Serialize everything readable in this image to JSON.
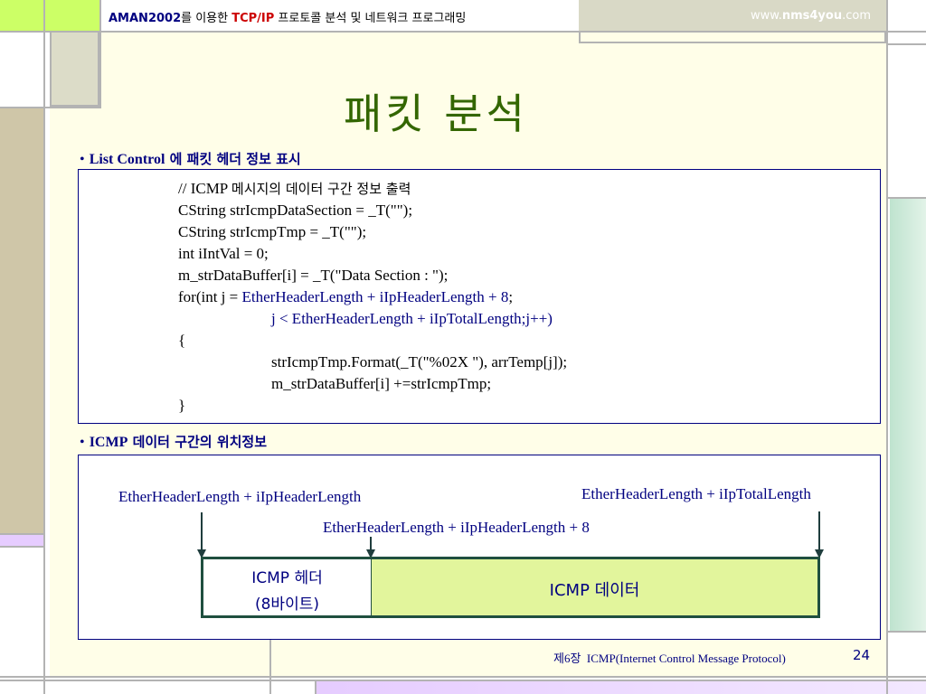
{
  "header": {
    "brand": "AMAN2002",
    "title_mid": "를 이용한 ",
    "tcpip": "TCP/IP",
    "title_rest": " 프로토콜 분석 및 네트워크 프로그래밍",
    "site_pre": "www.",
    "site_bold": "nms4you",
    "site_post": ".com"
  },
  "slide": {
    "title": "패킷 분석",
    "bullet1_en": "List Control",
    "bullet1_ko": " 에 패킷 헤더 정보 표시",
    "bullet2_en": "ICMP",
    "bullet2_ko": " 데이터 구간의 위치정보",
    "bullet_mark": "•"
  },
  "code": {
    "lines": [
      "// ICMP 메시지의 데이터 구간 정보 출력",
      "CString strIcmpDataSection = _T(\"\");",
      "CString strIcmpTmp = _T(\"\");",
      "int iIntVal = 0;",
      "m_strDataBuffer[i] = _T(\"Data Section : \");",
      "for(int j = ",
      "EtherHeaderLength + iIpHeaderLength + 8",
      ";",
      "j < EtherHeaderLength + iIpTotalLength",
      ";j++)",
      "{",
      "strIcmpTmp.Format(_T(\"%02X \"), arrTemp[j]);",
      "m_strDataBuffer[i] +=strIcmpTmp;",
      "}"
    ]
  },
  "diagram": {
    "label_left": "EtherHeaderLength + iIpHeaderLength",
    "label_right": "EtherHeaderLength + iIpTotalLength",
    "label_mid": "EtherHeaderLength + iIpHeaderLength + 8",
    "header_box_line1": "ICMP 헤더",
    "header_box_line2": "(8바이트)",
    "data_box": "ICMP 데이터"
  },
  "footer": {
    "chapter": "제6장  ICMP(Internet Control Message Protocol)",
    "page": "24"
  },
  "colors": {
    "lime": "#ccff66",
    "title_green": "#336600",
    "cream": "#ffffe5",
    "gray_panel": "#d9d9c6",
    "tan": "#ccc2a0",
    "lavender": "#e6ccff",
    "mint": "#cfe8d8",
    "data_fill": "#e0f59a",
    "box_border": "#1f4f3f"
  }
}
